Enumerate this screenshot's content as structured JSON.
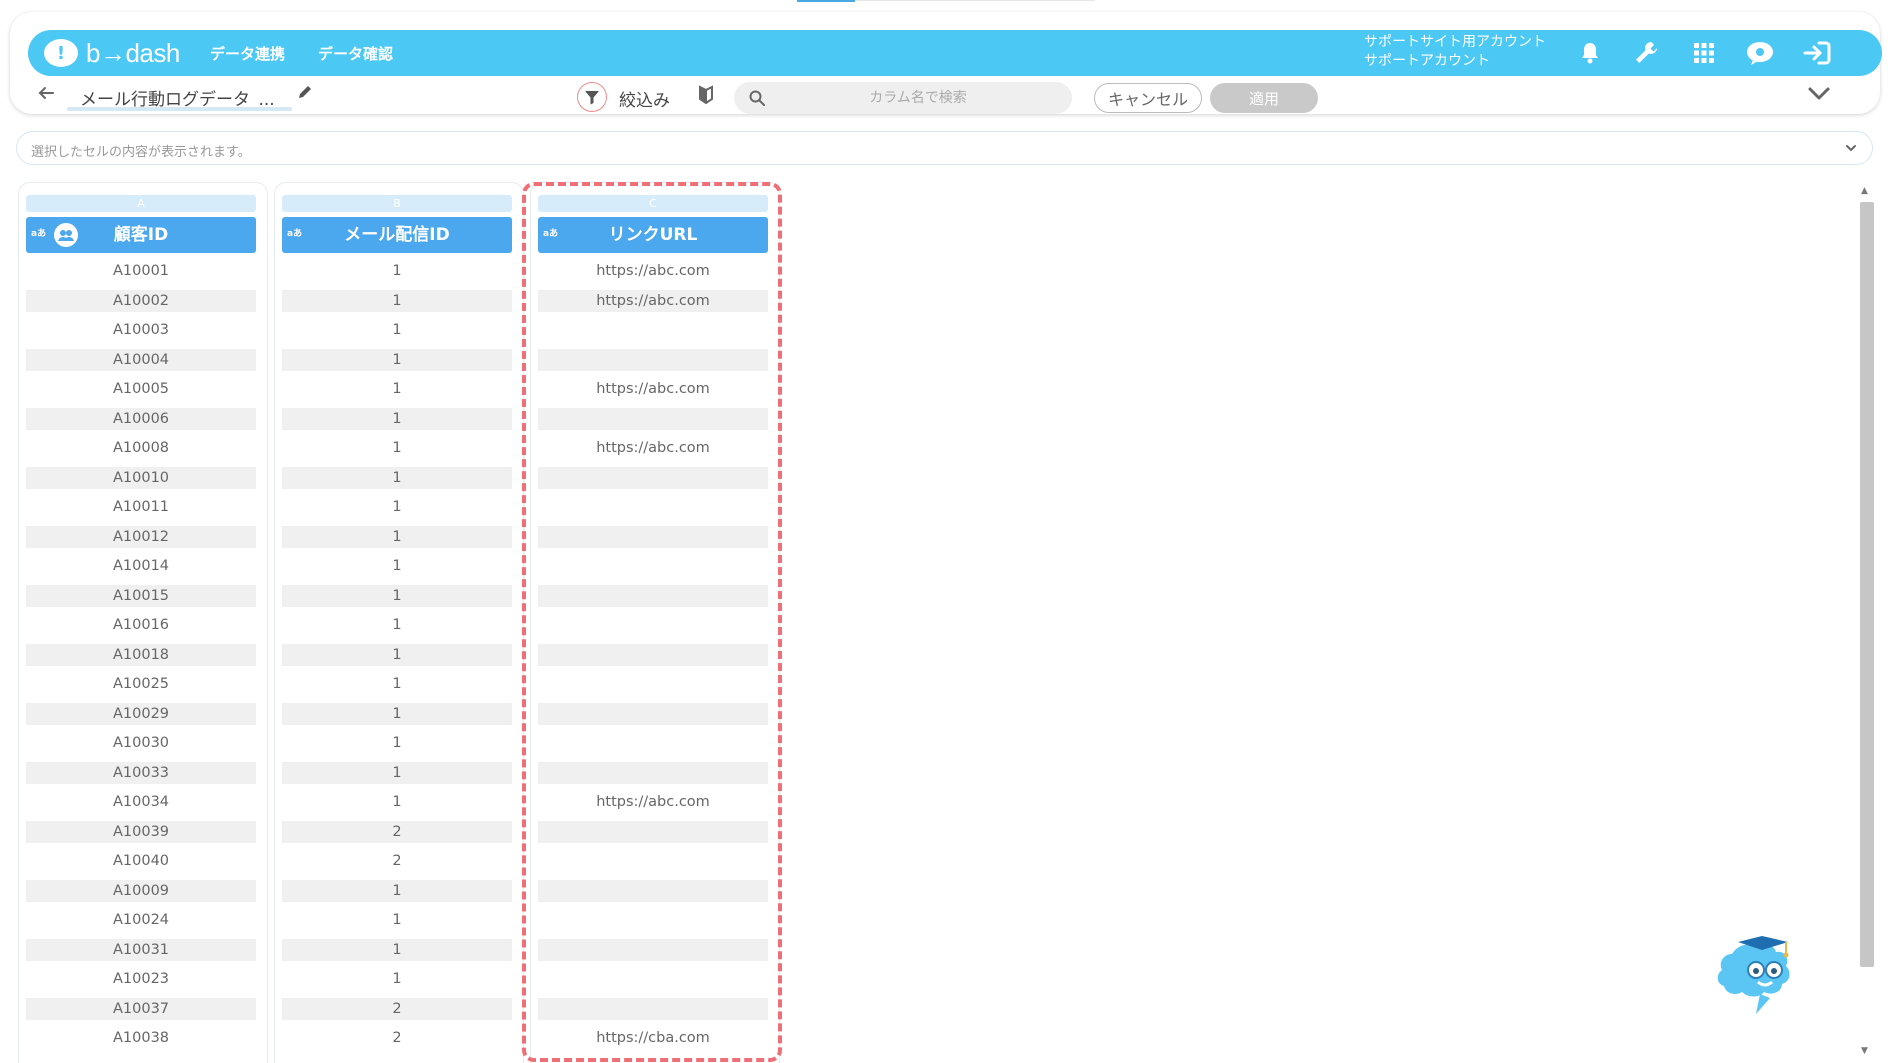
{
  "app": {
    "logo_text": "b→dash",
    "nav": [
      "データ連携",
      "データ確認"
    ],
    "account_line1": "サポートサイト用アカウント",
    "account_line2": "サポートアカウント",
    "icons": [
      "bell-icon",
      "wrench-icon",
      "grid-apps-icon",
      "support-chat-icon",
      "logout-icon"
    ],
    "accent_color": "#4cc8f5"
  },
  "toolbar": {
    "title": "メール行動ログデータ_...",
    "filter_label": "絞込み",
    "search_placeholder": "カラム名で検索",
    "cancel_label": "キャンセル",
    "apply_label": "適用"
  },
  "cell_bar": {
    "placeholder": "選択したセルの内容が表示されます。"
  },
  "columns": [
    {
      "letter": "A",
      "header": "顧客ID",
      "type_badge": "aあ"
    },
    {
      "letter": "B",
      "header": "メール配信ID",
      "type_badge": "aあ"
    },
    {
      "letter": "C",
      "header": "リンクURL",
      "type_badge": "aあ"
    }
  ],
  "rows": [
    [
      "A10001",
      "1",
      "https://abc.com"
    ],
    [
      "A10002",
      "1",
      "https://abc.com"
    ],
    [
      "A10003",
      "1",
      ""
    ],
    [
      "A10004",
      "1",
      ""
    ],
    [
      "A10005",
      "1",
      "https://abc.com"
    ],
    [
      "A10006",
      "1",
      ""
    ],
    [
      "A10008",
      "1",
      "https://abc.com"
    ],
    [
      "A10010",
      "1",
      ""
    ],
    [
      "A10011",
      "1",
      ""
    ],
    [
      "A10012",
      "1",
      ""
    ],
    [
      "A10014",
      "1",
      ""
    ],
    [
      "A10015",
      "1",
      ""
    ],
    [
      "A10016",
      "1",
      ""
    ],
    [
      "A10018",
      "1",
      ""
    ],
    [
      "A10025",
      "1",
      ""
    ],
    [
      "A10029",
      "1",
      ""
    ],
    [
      "A10030",
      "1",
      ""
    ],
    [
      "A10033",
      "1",
      ""
    ],
    [
      "A10034",
      "1",
      "https://abc.com"
    ],
    [
      "A10039",
      "2",
      ""
    ],
    [
      "A10040",
      "2",
      ""
    ],
    [
      "A10009",
      "1",
      ""
    ],
    [
      "A10024",
      "1",
      ""
    ],
    [
      "A10031",
      "1",
      ""
    ],
    [
      "A10023",
      "1",
      ""
    ],
    [
      "A10037",
      "2",
      ""
    ],
    [
      "A10038",
      "2",
      "https://cba.com"
    ]
  ],
  "highlight_color": "#ef6f78"
}
